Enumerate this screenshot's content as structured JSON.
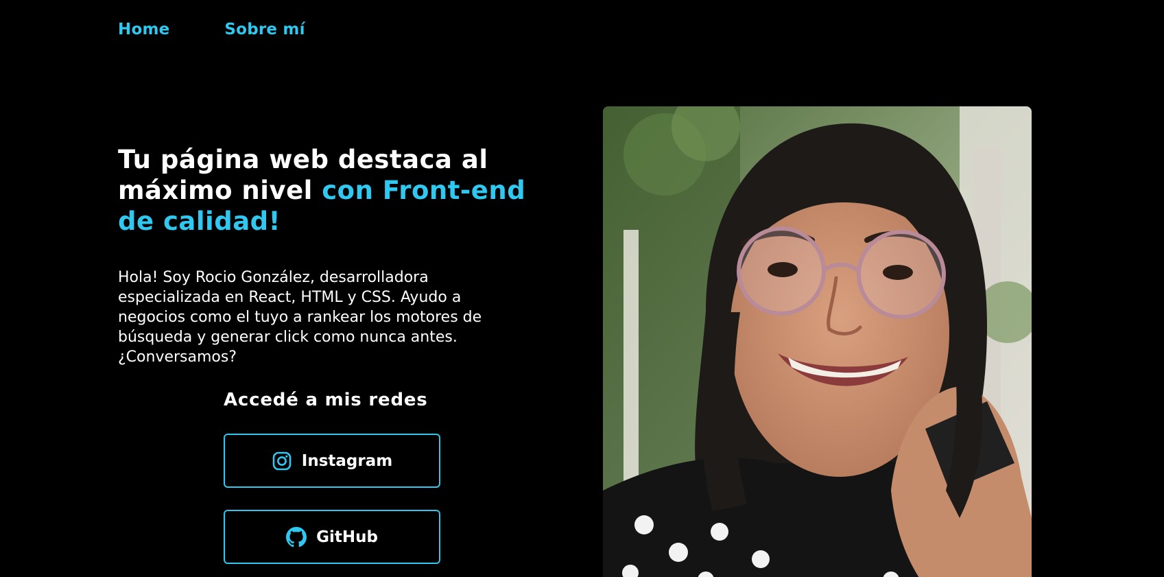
{
  "nav": {
    "home": "Home",
    "about": "Sobre mí"
  },
  "hero": {
    "headline_white": "Tu página web destaca al máximo nivel ",
    "headline_accent": "con Front-end de calidad!",
    "intro": "Hola! Soy Rocio González, desarrolladora especializada en React, HTML y CSS. Ayudo a negocios como el tuyo a rankear los motores de búsqueda y generar click como nunca antes. ¿Conversamos?"
  },
  "socials": {
    "title": "Accedé a mis redes",
    "instagram_label": "Instagram",
    "instagram_icon": "instagram-icon",
    "github_label": "GitHub",
    "github_icon": "github-icon"
  },
  "colors": {
    "accent": "#2ec8f0",
    "background": "#000000",
    "text": "#ffffff"
  }
}
